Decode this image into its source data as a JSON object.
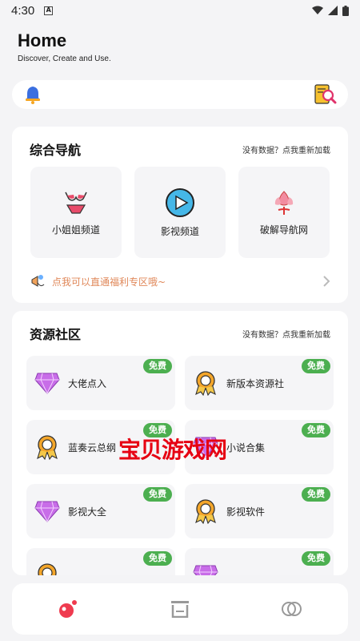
{
  "status_bar": {
    "time": "4:30",
    "notif_letter": "A"
  },
  "header": {
    "title": "Home",
    "subtitle": "Discover, Create and Use."
  },
  "search": {
    "left_icon": "bell-icon",
    "right_icon": "doc-search-icon"
  },
  "nav_card": {
    "title": "综合导航",
    "reload_text": "没有数据？点我重新加载",
    "tiles": [
      {
        "label": "小姐姐频道",
        "icon": "bikini-icon"
      },
      {
        "label": "影视频道",
        "icon": "play-circle-icon"
      },
      {
        "label": "破解导航网",
        "icon": "lotus-icon"
      }
    ],
    "promo_text": "点我可以直通福利专区哦~"
  },
  "resource_card": {
    "title": "资源社区",
    "reload_text": "没有数据？点我重新加载",
    "badge": "免费",
    "items": [
      {
        "label": "大佬点入",
        "icon": "gem-icon"
      },
      {
        "label": "新版本资源社",
        "icon": "medal-icon"
      },
      {
        "label": "蓝奏云总纲",
        "icon": "medal-icon"
      },
      {
        "label": "小说合集",
        "icon": "gem-icon"
      },
      {
        "label": "影视大全",
        "icon": "gem-icon"
      },
      {
        "label": "影视软件",
        "icon": "medal-icon"
      },
      {
        "label": "",
        "icon": "medal-icon"
      },
      {
        "label": "",
        "icon": "gem-icon"
      }
    ]
  },
  "watermark": "宝贝游戏网",
  "tabbar": {
    "tabs": [
      "home-tab-icon",
      "archive-tab-icon",
      "circles-tab-icon"
    ],
    "active": "home-tab-icon"
  },
  "colors": {
    "accent": "#ef3b4f",
    "badge": "#4caf50",
    "promo": "#e0885a"
  }
}
